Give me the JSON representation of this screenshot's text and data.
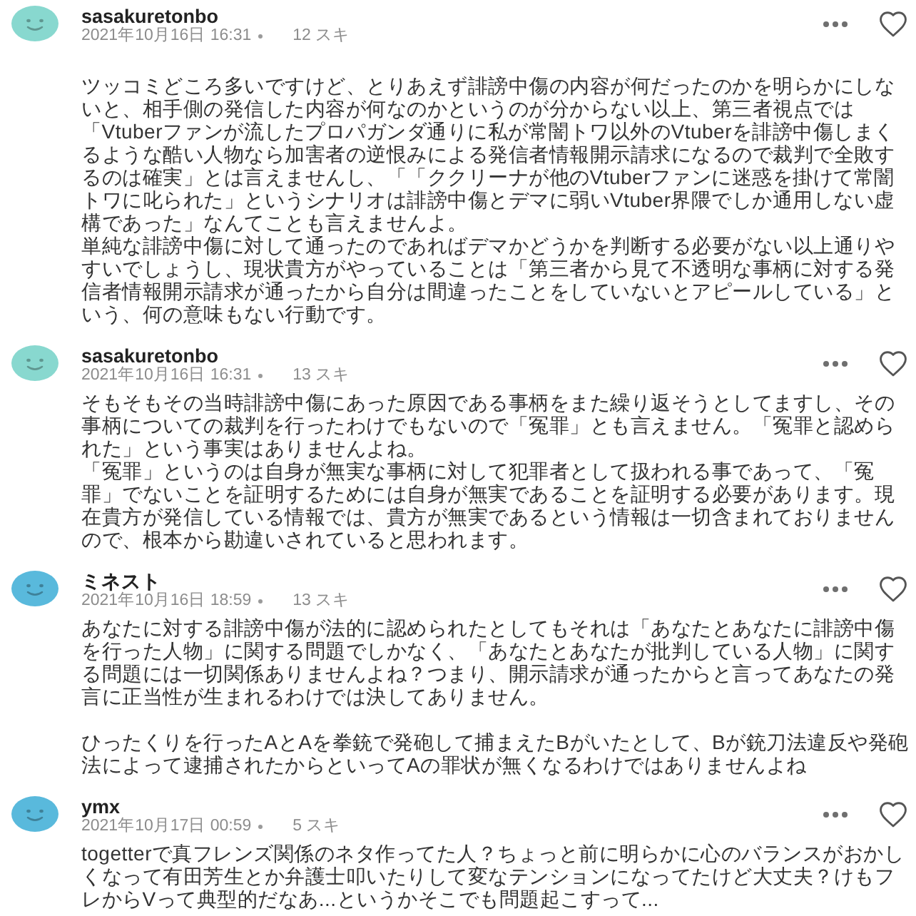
{
  "comments": [
    {
      "user": "sasakuretonbo",
      "color": "#88d8cf",
      "date": "2021年10月16日 16:31",
      "likes": "12 スキ",
      "liked": false,
      "sections": [
        {
          "paragraphs": [
            "ツッコミどころ多いですけど、とりあえず誹謗中傷の内容が何だったのかを明らかにしないと、相手側の発信した内容が何なのかというのが分からない以上、第三者視点では「Vtuberファンが流したプロパガンダ通りに私が常闇トワ以外のVtuberを誹謗中傷しまくるような酷い人物なら加害者の逆恨みによる発信者情報開示請求になるので裁判で全敗するのは確実」とは言えませんし、「「ククリーナが他のVtuberファンに迷惑を掛けて常闇トワに叱られた」というシナリオは誹謗中傷とデマに弱いVtuber界隈でしか通用しない虚構であった」なんてことも言えませんよ。",
            "単純な誹謗中傷に対して通ったのであればデマかどうかを判断する必要がない以上通りやすいでしょうし、現状貴方がやっていることは「第三者から見て不透明な事柄に対する発信者情報開示請求が通ったから自分は間違ったことをしていないとアピールしている」という、何の意味もない行動です。"
          ]
        }
      ]
    },
    {
      "user": "sasakuretonbo",
      "color": "#88d8cf",
      "date": "2021年10月16日 16:31",
      "likes": "13 スキ",
      "liked": false,
      "sections": [
        {
          "paragraphs": [
            "そもそもその当時誹謗中傷にあった原因である事柄をまた繰り返そうとしてますし、その事柄についての裁判を行ったわけでもないので「冤罪」とも言えません。「冤罪と認められた」という事実はありませんよね。",
            "「冤罪」というのは自身が無実な事柄に対して犯罪者として扱われる事であって、「冤罪」でないことを証明するためには自身が無実であることを証明する必要があります。現在貴方が発信している情報では、貴方が無実であるという情報は一切含まれておりませんので、根本から勘違いされていると思われます。"
          ]
        }
      ]
    },
    {
      "user": "ミネスト",
      "color": "#59b9dc",
      "date": "2021年10月16日 18:59",
      "likes": "13 スキ",
      "liked": false,
      "sections": [
        {
          "paragraphs": [
            "あなたに対する誹謗中傷が法的に認められたとしてもそれは「あなたとあなたに誹謗中傷を行った人物」に関する問題でしかなく、「あなたとあなたが批判している人物」に関する問題には一切関係ありませんよね？つまり、開示請求が通ったからと言ってあなたの発言に正当性が生まれるわけでは決してありません。"
          ]
        },
        {
          "paragraphs": [
            "ひったくりを行ったAとAを拳銃で発砲して捕まえたBがいたとして、Bが銃刀法違反や発砲法によって逮捕されたからといってAの罪状が無くなるわけではありませんよね"
          ]
        }
      ]
    },
    {
      "user": "ymx",
      "color": "#59b9dc",
      "date": "2021年10月17日 00:59",
      "likes": "5 スキ",
      "liked": false,
      "sections": [
        {
          "paragraphs": [
            "togetterで真フレンズ関係のネタ作ってた人？ちょっと前に明らかに心のバランスがおかしくなって有田芳生とか弁護士叩いたりして変なテンションになってたけど大丈夫？けもフレからVって典型的だなあ...というかそこでも問題起こすって..."
          ]
        }
      ]
    }
  ]
}
